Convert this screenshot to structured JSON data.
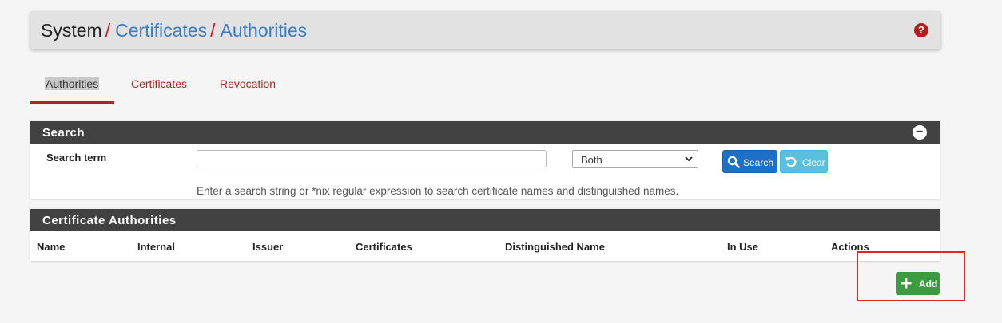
{
  "breadcrumb": {
    "root": "System",
    "sep": "/",
    "items": [
      "Certificates",
      "Authorities"
    ]
  },
  "help_icon": "?",
  "tabs": [
    {
      "label": "Authorities",
      "active": true
    },
    {
      "label": "Certificates",
      "active": false
    },
    {
      "label": "Revocation",
      "active": false
    }
  ],
  "search_panel": {
    "title": "Search",
    "collapse_icon": "−",
    "term_label": "Search term",
    "term_value": "",
    "scope_selected": "Both",
    "search_button": "Search",
    "clear_button": "Clear",
    "help_text": "Enter a search string or *nix regular expression to search certificate names and distinguished names."
  },
  "ca_panel": {
    "title": "Certificate Authorities",
    "columns": [
      "Name",
      "Internal",
      "Issuer",
      "Certificates",
      "Distinguished Name",
      "In Use",
      "Actions"
    ],
    "rows": []
  },
  "add_button": "Add",
  "colors": {
    "accent_red": "#b0241f",
    "link_blue": "#3b7dc2",
    "panel_heading": "#424242",
    "search_button": "#1e6fc6",
    "clear_button": "#5bc0de",
    "add_button": "#3a9c3f",
    "annotation_box": "#e32626"
  },
  "icons": {
    "help": "help-icon",
    "collapse": "minus-circle-icon",
    "search": "search-icon",
    "clear": "undo-icon",
    "add": "plus-icon",
    "select": "chevron-down-icon"
  }
}
